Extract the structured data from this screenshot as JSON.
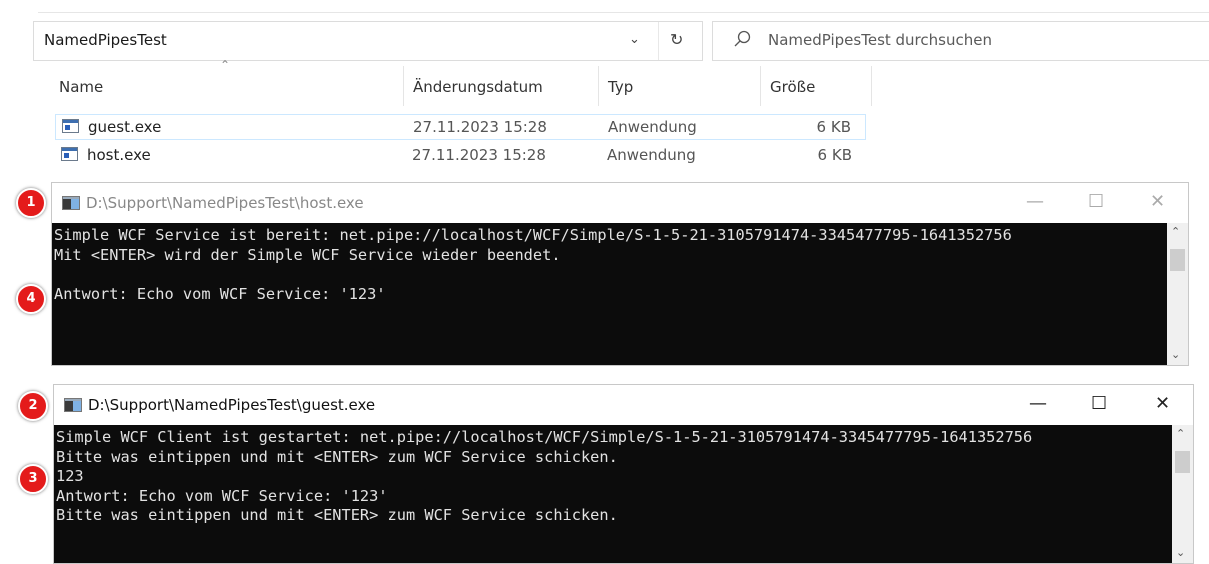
{
  "explorer": {
    "address_path": "NamedPipesTest",
    "search_placeholder": "NamedPipesTest durchsuchen",
    "columns": [
      "Name",
      "Änderungsdatum",
      "Typ",
      "Größe"
    ],
    "files": [
      {
        "name": "guest.exe",
        "date": "27.11.2023 15:28",
        "type": "Anwendung",
        "size": "6 KB"
      },
      {
        "name": "host.exe",
        "date": "27.11.2023 15:28",
        "type": "Anwendung",
        "size": "6 KB"
      }
    ]
  },
  "host_window": {
    "title": "D:\\Support\\NamedPipesTest\\host.exe",
    "lines": [
      "Simple WCF Service ist bereit: net.pipe://localhost/WCF/Simple/S-1-5-21-3105791474-3345477795-1641352756",
      "Mit <ENTER> wird der Simple WCF Service wieder beendet.",
      "",
      "Antwort: Echo vom WCF Service: '123'"
    ]
  },
  "guest_window": {
    "title": "D:\\Support\\NamedPipesTest\\guest.exe",
    "lines": [
      "Simple WCF Client ist gestartet: net.pipe://localhost/WCF/Simple/S-1-5-21-3105791474-3345477795-1641352756",
      "Bitte was eintippen und mit <ENTER> zum WCF Service schicken.",
      "123",
      "Antwort: Echo vom WCF Service: '123'",
      "Bitte was eintippen und mit <ENTER> zum WCF Service schicken."
    ]
  },
  "window_controls": {
    "minimize": "—",
    "maximize": "☐",
    "close": "✕"
  },
  "badges": [
    "1",
    "2",
    "3",
    "4"
  ],
  "colors": {
    "badge_red": "#e41b1b",
    "console_bg": "#0c0c0c",
    "selection_border": "#cce8ff"
  }
}
